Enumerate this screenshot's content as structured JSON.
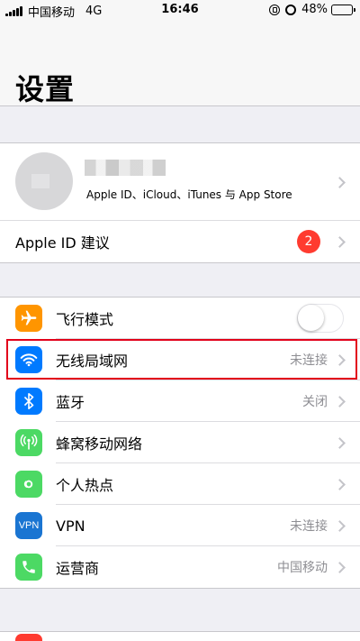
{
  "status_bar": {
    "carrier": "中国移动",
    "network": "4G",
    "time": "16:46",
    "battery": "48%"
  },
  "header": {
    "title": "设置"
  },
  "profile": {
    "subtitle": "Apple ID、iCloud、iTunes 与 App Store"
  },
  "apple_id_suggestions": {
    "label": "Apple ID 建议",
    "badge": "2"
  },
  "settings": [
    {
      "key": "airplane",
      "label": "飞行模式",
      "icon": "airplane-icon",
      "color": "#ff9500",
      "toggle": false
    },
    {
      "key": "wifi",
      "label": "无线局域网",
      "detail": "未连接",
      "icon": "wifi-icon",
      "color": "#007aff"
    },
    {
      "key": "bluetooth",
      "label": "蓝牙",
      "detail": "关闭",
      "icon": "bluetooth-icon",
      "color": "#007aff"
    },
    {
      "key": "cellular",
      "label": "蜂窝移动网络",
      "icon": "cellular-icon",
      "color": "#4cd964"
    },
    {
      "key": "hotspot",
      "label": "个人热点",
      "icon": "hotspot-icon",
      "color": "#4cd964"
    },
    {
      "key": "vpn",
      "label": "VPN",
      "detail": "未连接",
      "icon": "vpn-icon",
      "icon_text": "VPN",
      "color": "#1a75d2"
    },
    {
      "key": "carrier",
      "label": "运营商",
      "detail": "中国移动",
      "icon": "phone-icon",
      "color": "#4cd964"
    }
  ]
}
